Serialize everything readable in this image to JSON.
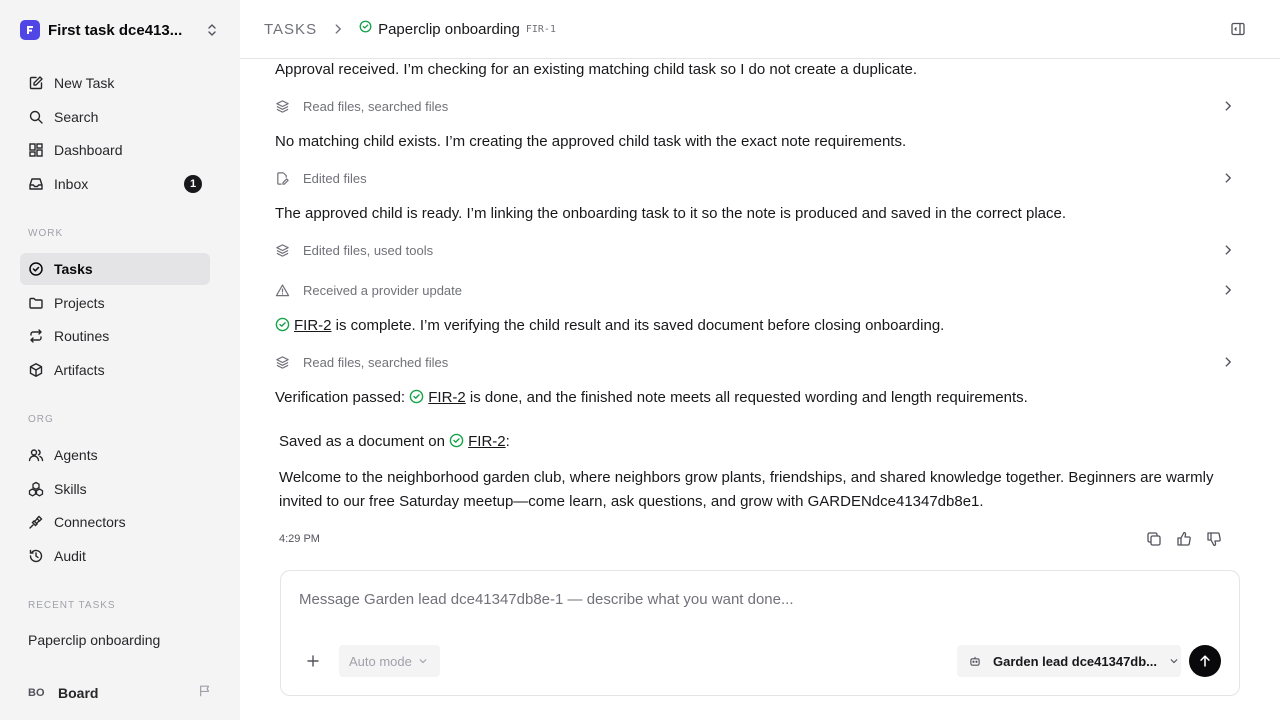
{
  "workspace": {
    "name": "First task dce413...",
    "logo_color": "#4f46e5"
  },
  "nav": {
    "new_task": "New Task",
    "search": "Search",
    "dashboard": "Dashboard",
    "inbox": "Inbox",
    "inbox_badge": "1"
  },
  "sections": {
    "work": "WORK",
    "org": "ORG",
    "recent": "RECENT TASKS"
  },
  "work_items": {
    "tasks": "Tasks",
    "projects": "Projects",
    "routines": "Routines",
    "artifacts": "Artifacts"
  },
  "org_items": {
    "agents": "Agents",
    "skills": "Skills",
    "connectors": "Connectors",
    "audit": "Audit"
  },
  "recent_tasks": [
    "Paperclip onboarding"
  ],
  "board": {
    "initials": "BO",
    "label": "Board"
  },
  "header": {
    "root": "TASKS",
    "title": "Paperclip onboarding",
    "id": "FIR-1"
  },
  "thread": {
    "msg1": "Approval received. I’m checking for an existing matching child task so I do not create a duplicate.",
    "tool1": "Read files, searched files",
    "msg2": "No matching child exists. I’m creating the approved child task with the exact note requirements.",
    "tool2": "Edited files",
    "msg3": "The approved child is ready. I’m linking the onboarding task to it so the note is produced and saved in the correct place.",
    "tool3": "Edited files, used tools",
    "tool4": "Received a provider update",
    "msg4_link": "FIR-2",
    "msg4_text": " is complete. I’m verifying the child result and its saved document before closing onboarding.",
    "tool5": "Read files, searched files",
    "msg5_prefix": "Verification passed: ",
    "msg5_link": "FIR-2",
    "msg5_text": " is done, and the finished note meets all requested wording and length requirements.",
    "saved_prefix": "Saved as a document on ",
    "saved_link": "FIR-2",
    "saved_suffix": ":",
    "note": "Welcome to the neighborhood garden club, where neighbors grow plants, friendships, and shared knowledge together. Beginners are warmly invited to our free Saturday meetup—come learn, ask questions, and grow with GARDENdce41347db8e1.",
    "timestamp": "4:29 PM"
  },
  "composer": {
    "placeholder": "Message Garden lead dce41347db8e-1 — describe what you want done...",
    "mode": "Auto mode",
    "agent": "Garden lead dce41347db..."
  },
  "colors": {
    "status_done": "#16a34a",
    "active_bg": "#e4e4e7",
    "sidebar_bg": "#f4f4f5"
  }
}
